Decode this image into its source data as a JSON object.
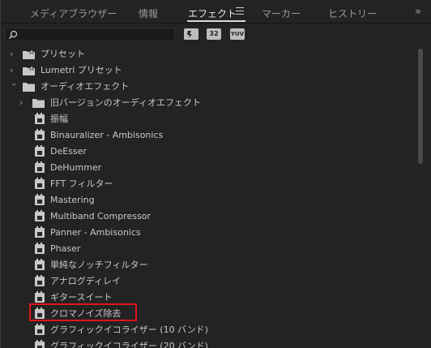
{
  "tabs": [
    {
      "label": "メディアブラウザー",
      "active": false
    },
    {
      "label": "情報",
      "active": false
    },
    {
      "label": "エフェクト",
      "active": true
    },
    {
      "label": "マーカー",
      "active": false
    },
    {
      "label": "ヒストリー",
      "active": false
    }
  ],
  "overflow_glyph": "»",
  "search": {
    "placeholder": "",
    "value": ""
  },
  "filters": [
    "accelerated-effects-icon",
    "32bit-color-icon",
    "yuv-effects-icon"
  ],
  "filter_labels": [
    "",
    "32",
    "YUV"
  ],
  "tree": [
    {
      "label": "プリセット",
      "type": "folder-star",
      "expanded": false
    },
    {
      "label": "Lumetri プリセット",
      "type": "folder-star",
      "expanded": false
    },
    {
      "label": "オーディオエフェクト",
      "type": "folder",
      "expanded": true
    },
    {
      "label": "旧バージョンのオーディオエフェクト",
      "type": "folder",
      "expanded": false
    },
    {
      "label": "振幅",
      "type": "effect"
    },
    {
      "label": "Binauralizer - Ambisonics",
      "type": "effect"
    },
    {
      "label": "DeEsser",
      "type": "effect"
    },
    {
      "label": "DeHummer",
      "type": "effect"
    },
    {
      "label": "FFT フィルター",
      "type": "effect"
    },
    {
      "label": "Mastering",
      "type": "effect"
    },
    {
      "label": "Multiband Compressor",
      "type": "effect"
    },
    {
      "label": "Panner - Ambisonics",
      "type": "effect"
    },
    {
      "label": "Phaser",
      "type": "effect"
    },
    {
      "label": "単純なノッチフィルター",
      "type": "effect"
    },
    {
      "label": "アナログディレイ",
      "type": "effect"
    },
    {
      "label": "ギタースイート",
      "type": "effect"
    },
    {
      "label": "クロマノイズ除去",
      "type": "effect",
      "highlighted": true
    },
    {
      "label": "グラフィックイコライザー (10 バンド)",
      "type": "effect"
    },
    {
      "label": "グラフィックイコライザー (20 バンド)",
      "type": "effect"
    }
  ],
  "colors": {
    "highlight": "#e0141b",
    "background": "#232323"
  }
}
